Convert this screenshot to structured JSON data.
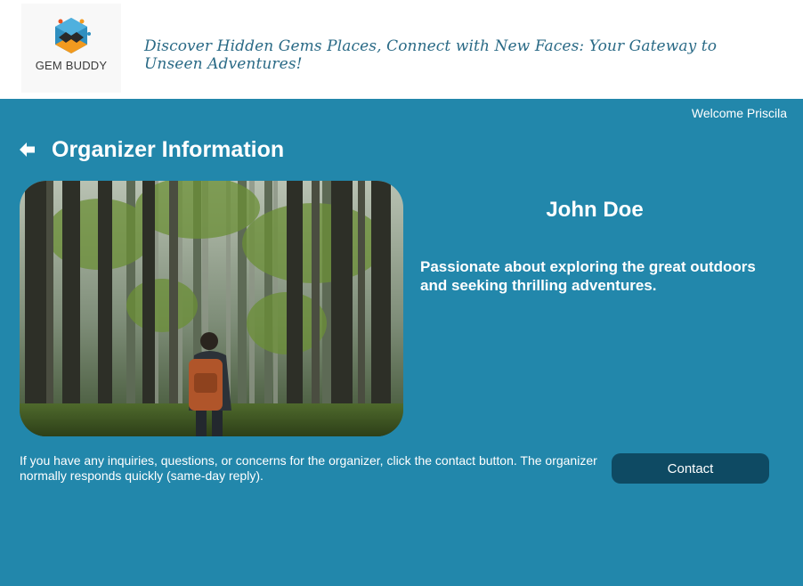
{
  "brand": {
    "logo_text": "GEM BUDDY",
    "logo_icon": "handshake-gem-icon",
    "tagline": "Discover Hidden Gems Places, Connect with New Faces: Your Gateway to Unseen Adventures!"
  },
  "user": {
    "welcome": "Welcome Priscila"
  },
  "page": {
    "back_icon": "back-arrow-icon",
    "title": "Organizer Information"
  },
  "organizer": {
    "name": "John Doe",
    "bio": "Passionate about exploring the great outdoors and seeking thrilling adventures.",
    "photo": "forest-hiker-photo"
  },
  "contact": {
    "note": "If you have any inquiries, questions, or concerns for the organizer, click the contact button. The organizer normally responds quickly (same-day reply).",
    "button_label": "Contact"
  },
  "colors": {
    "background": "#2287ab",
    "header": "#ffffff",
    "button": "#0e4a63",
    "tagline": "#2a6a86"
  }
}
